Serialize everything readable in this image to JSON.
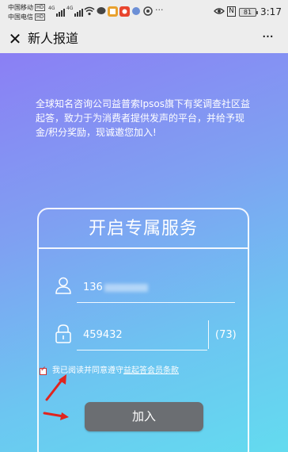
{
  "statusbar": {
    "carrier1": "中国移动",
    "carrier2": "中国电信",
    "hd": "HD",
    "net": "4G",
    "battery": "81",
    "time": "3:17",
    "nfc": "N",
    "dots": "···"
  },
  "titlebar": {
    "close": "✕",
    "title": "新人报道",
    "more": "···"
  },
  "intro": "全球知名咨询公司益普索Ipsos旗下有奖调查社区益起答，致力于为消费者提供发声的平台，并给予现金/积分奖励，现诚邀您加入!",
  "card": {
    "title": "开启专属服务",
    "phone_value": "136",
    "code_value": "459432",
    "code_count": "(73)",
    "agree_text": "我已阅读并同意遵守",
    "agree_link": "益起答会员条款",
    "join_label": "加入"
  },
  "colors": {
    "gradient_start": "#8b7ff4",
    "gradient_end": "#63dbef",
    "join_button": "#6b6e72",
    "annotation_arrow": "#e0241f"
  }
}
